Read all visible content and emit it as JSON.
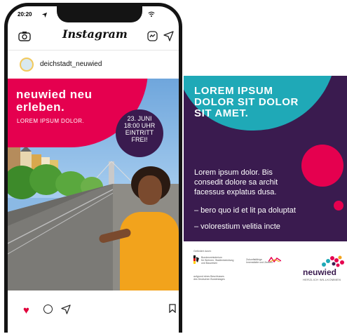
{
  "phone": {
    "status_time": "20:20",
    "app_title": "Instagram",
    "username": "deichstadt_neuwied"
  },
  "post": {
    "headline_line1": "neuwied neu",
    "headline_line2": "erleben.",
    "subline": "LOREM IPSUM DOLOR.",
    "event": {
      "line1": "23. JUNI",
      "line2": "18:00 UHR",
      "line3": "EINTRITT",
      "line4": "FREI!"
    }
  },
  "poster": {
    "headline_line1": "LOREM IPSUM",
    "headline_line2": "DOLOR SIT DOLOR",
    "headline_line3": "SIT AMET.",
    "body_line1": "Lorem ipsum dolor. Bis",
    "body_line2": "consedit dolore sa archit",
    "body_line3": "facessus explatus dusa.",
    "bullet1": "– bero quo id et lit pa doluptat",
    "bullet2": "– volorestium velitia incte"
  },
  "footer": {
    "funded_by": "Gefördert durch:",
    "ministry_line1": "Bundesministerium",
    "ministry_line2": "für Wohnen, Stadtentwicklung",
    "ministry_line3": "und Bauwesen",
    "zukunft_line1": "Zukunftsfähige",
    "zukunft_line2": "Innenstädte und Zentren",
    "basis_line1": "aufgrund eines Beschlusses",
    "basis_line2": "des Deutschen Bundestages",
    "logo_text": "neuwied",
    "logo_sub": "HERZLICH WILLKOMMEN"
  },
  "colors": {
    "pink": "#e5004f",
    "purple": "#3a1b4f",
    "teal": "#1fa9b7"
  }
}
